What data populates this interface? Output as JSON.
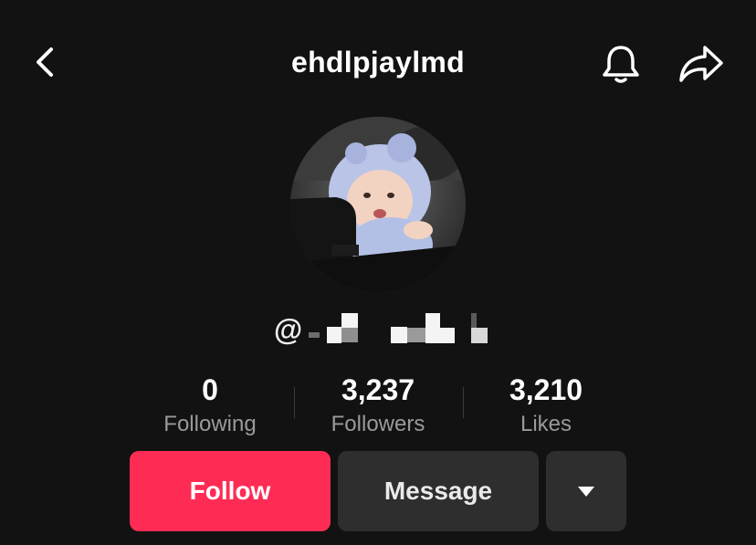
{
  "header": {
    "username": "ehdlpjaylmd",
    "back_icon": "chevron-left-icon",
    "bell_icon": "bell-icon",
    "share_icon": "share-arrow-icon"
  },
  "profile": {
    "avatar_description": "profile photo",
    "handle_prefix": "@"
  },
  "stats": [
    {
      "value": "0",
      "label": "Following"
    },
    {
      "value": "3,237",
      "label": "Followers"
    },
    {
      "value": "3,210",
      "label": "Likes"
    }
  ],
  "actions": {
    "follow_label": "Follow",
    "message_label": "Message",
    "more_icon": "triangle-down-icon"
  },
  "colors": {
    "background": "#121212",
    "follow": "#fe2c55",
    "secondary_button": "#2e2e2e",
    "muted_text": "#9a9a9a"
  }
}
